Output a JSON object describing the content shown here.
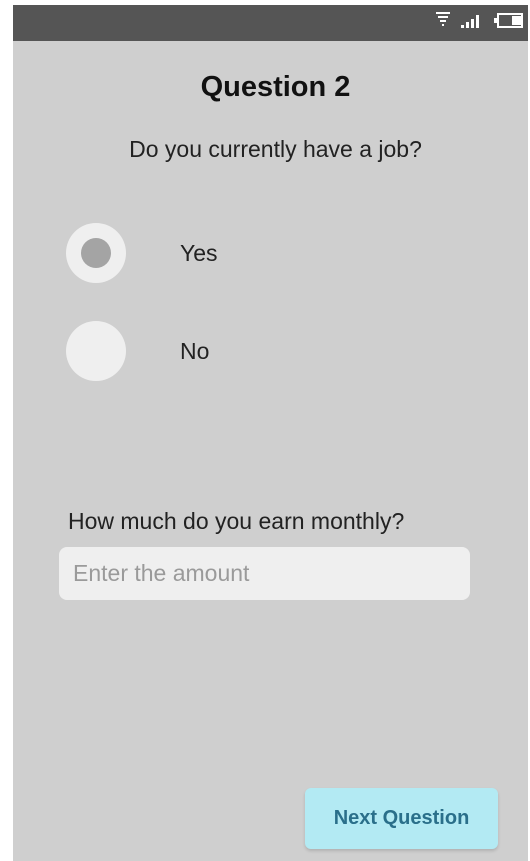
{
  "colors": {
    "background": "#cfcfcf",
    "status_bar": "#555555",
    "radio_fill": "#efefef",
    "radio_selected_dot": "#a4a4a4",
    "button_bg": "#b3eaf3",
    "button_text": "#2a6f8a"
  },
  "status_bar": {
    "icons": [
      "wifi-icon",
      "signal-icon",
      "battery-icon"
    ]
  },
  "screen": {
    "title": "Question 2",
    "question": "Do you currently have a job?",
    "options": [
      {
        "label": "Yes",
        "selected": true
      },
      {
        "label": "No",
        "selected": false
      }
    ],
    "amount": {
      "label": "How much do you earn monthly?",
      "value": "",
      "placeholder": "Enter the amount"
    },
    "next_label": "Next Question"
  }
}
